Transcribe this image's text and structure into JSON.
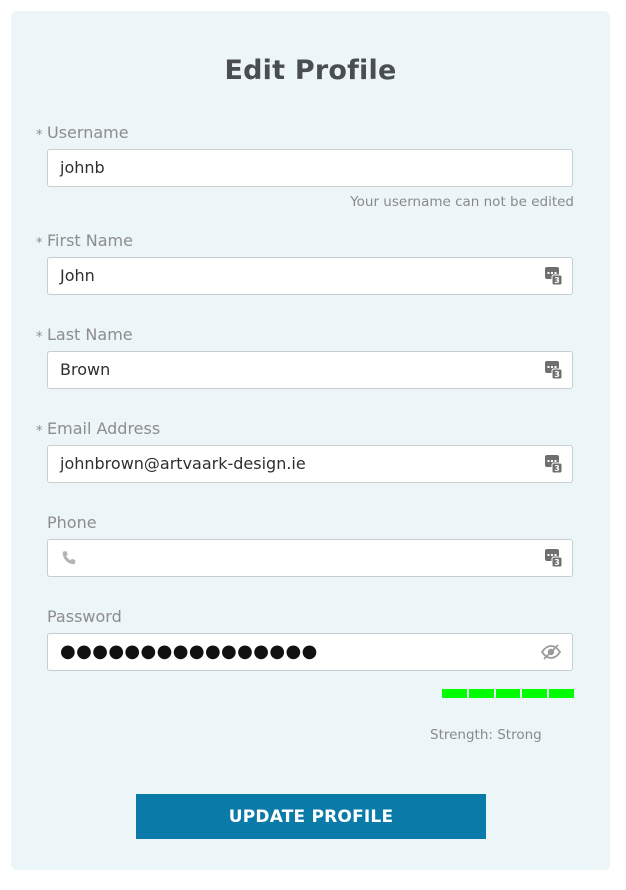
{
  "form": {
    "title": "Edit Profile",
    "required_marker": "*",
    "username": {
      "label": "Username",
      "value": "johnb",
      "hint": "Your username can not be edited"
    },
    "first_name": {
      "label": "First Name",
      "value": "John"
    },
    "last_name": {
      "label": "Last Name",
      "value": "Brown"
    },
    "email": {
      "label": "Email Address",
      "value": "johnbrown@artvaark-design.ie"
    },
    "phone": {
      "label": "Phone",
      "value": ""
    },
    "password": {
      "label": "Password",
      "value": "●●●●●●●●●●●●●●●●",
      "strength_text": "Strength: Strong",
      "strength_level": 5,
      "strength_max": 5,
      "strength_color": "#00ff00"
    },
    "submit_label": "UPDATE PROFILE"
  },
  "colors": {
    "card_bg": "#ecf5f8",
    "button_bg": "#0a7ba8",
    "button_text": "#ffffff"
  },
  "icons": {
    "autofill": "password-manager-icon",
    "phone": "phone-icon",
    "reveal": "eye-icon"
  }
}
